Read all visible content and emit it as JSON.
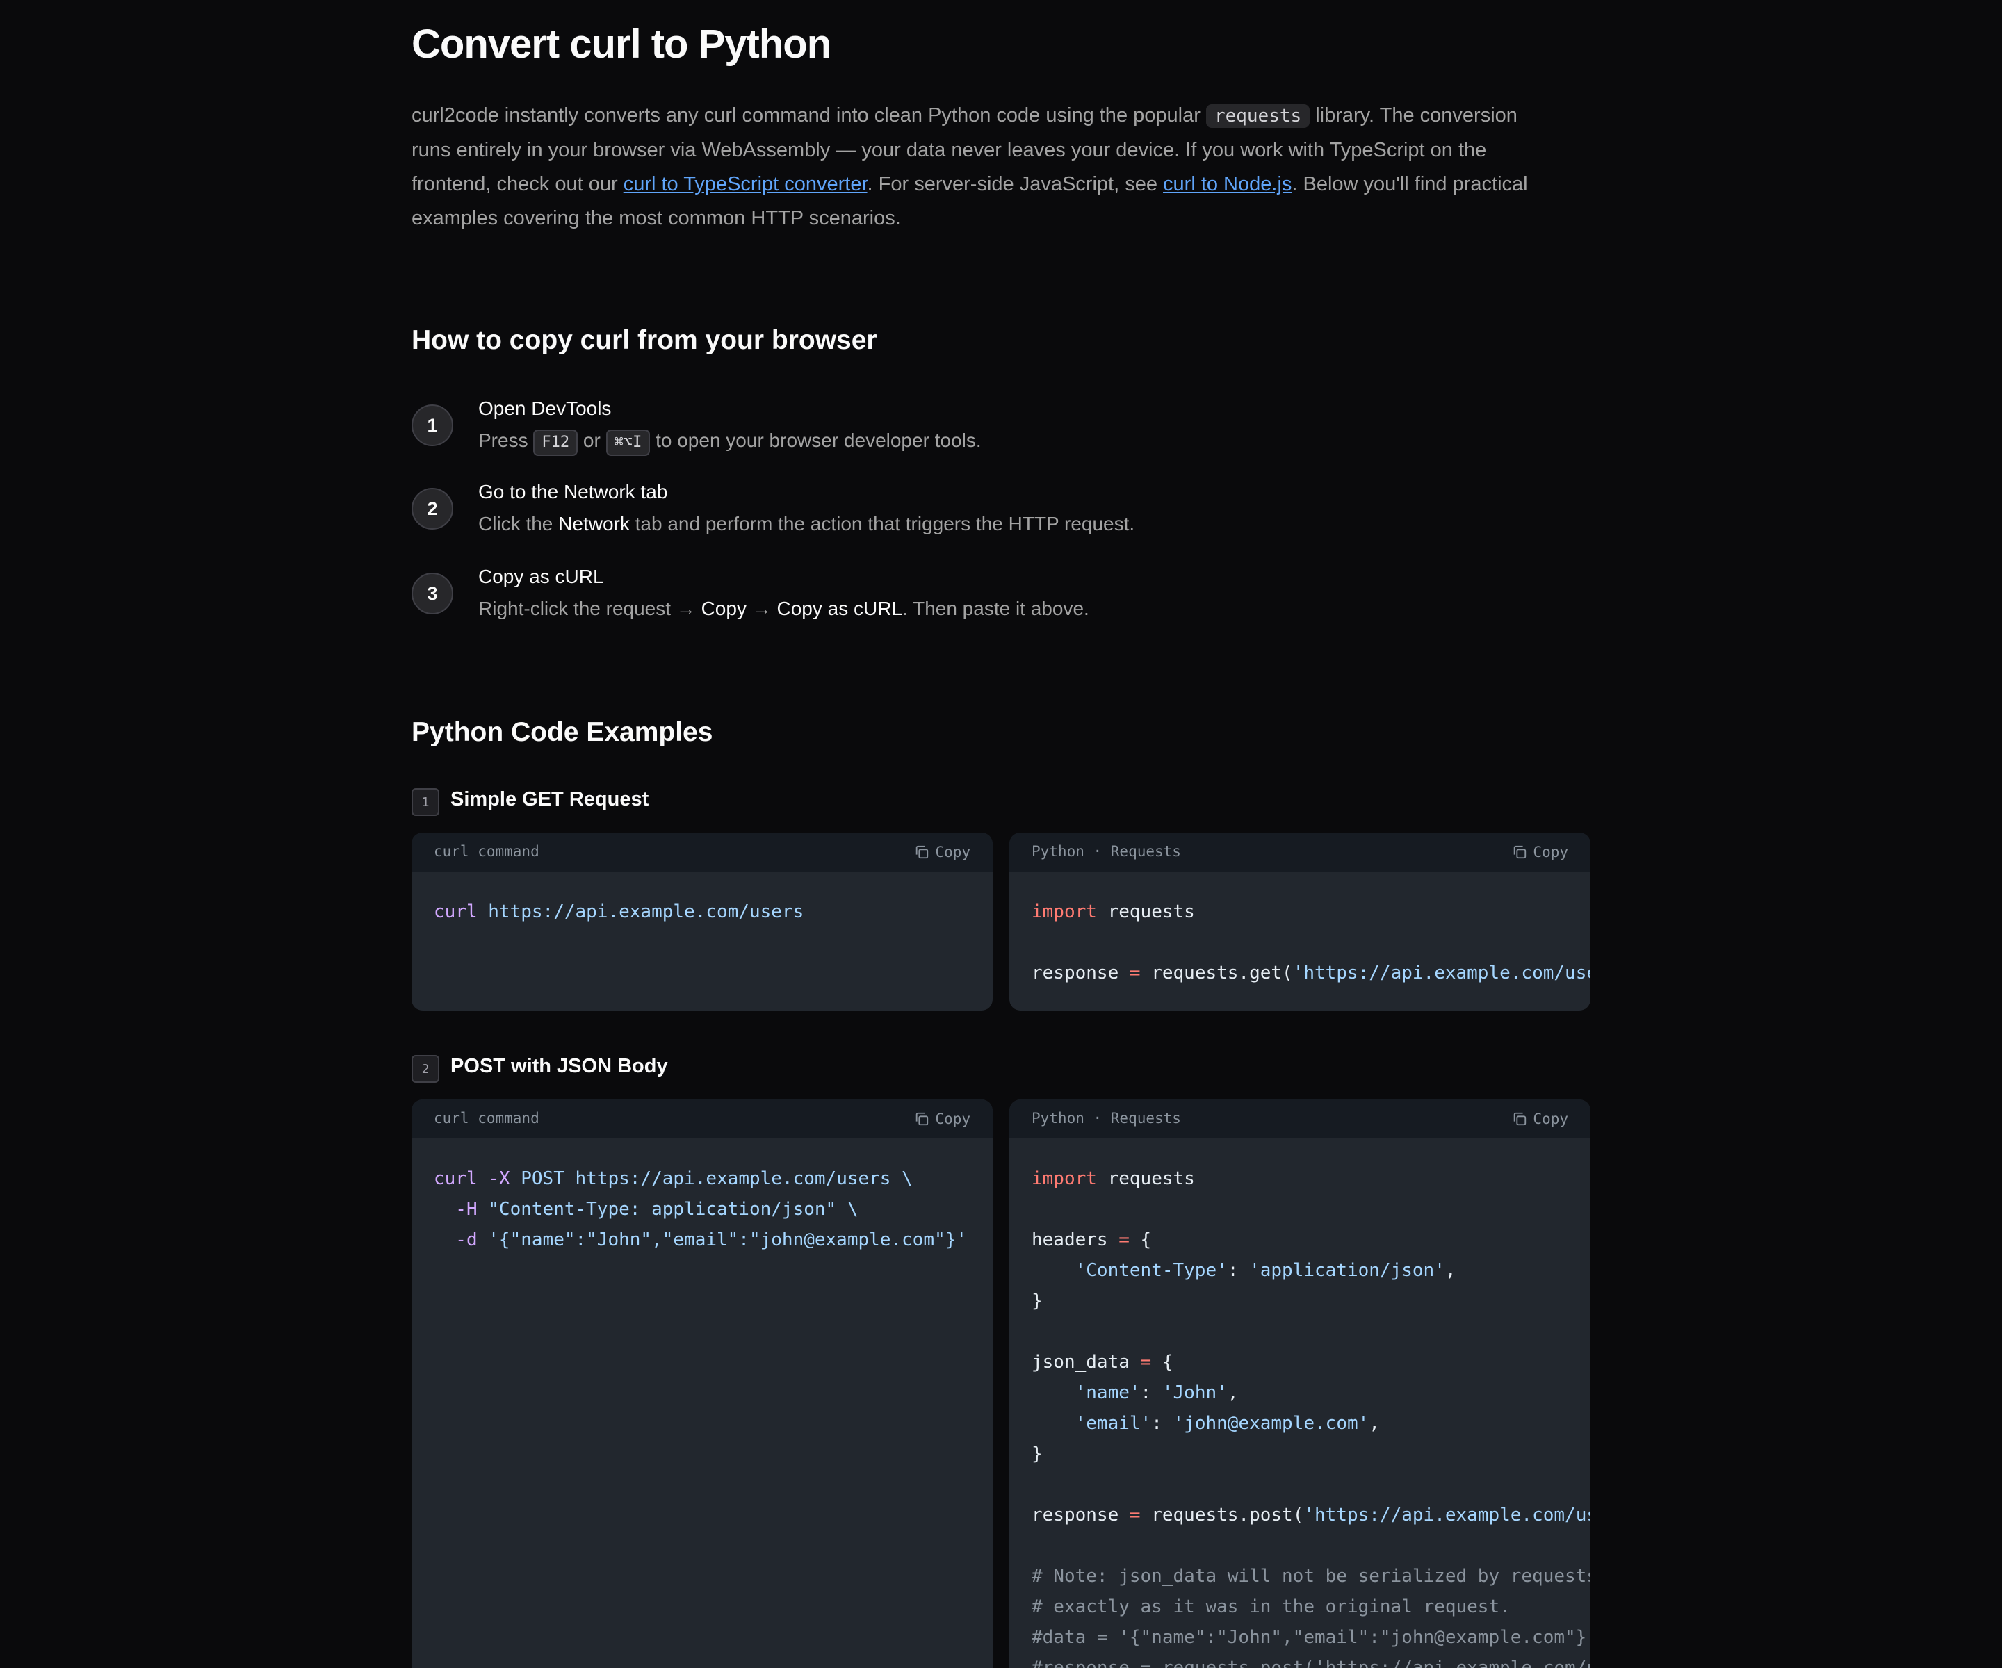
{
  "page": {
    "title": "Convert curl to Python",
    "intro": {
      "p1": "curl2code instantly converts any curl command into clean Python code using the popular ",
      "code": "requests",
      "p2": " library. The conversion runs entirely in your browser via WebAssembly — your data never leaves your device. If you work with TypeScript on the frontend, check out our ",
      "link1": "curl to TypeScript converter",
      "p3": ". For server-side JavaScript, see ",
      "link2": "curl to Node.js",
      "p4": ". Below you'll find practical examples covering the most common HTTP scenarios."
    }
  },
  "howto": {
    "heading": "How to copy curl from your browser",
    "steps": [
      {
        "num": "1",
        "title": "Open DevTools",
        "d1": "Press ",
        "k1": "F12",
        "d2": " or ",
        "k2": "⌘⌥I",
        "d3": " to open your browser developer tools."
      },
      {
        "num": "2",
        "title": "Go to the Network tab",
        "d1": "Click the ",
        "s1": "Network",
        "d2": " tab and perform the action that triggers the HTTP request."
      },
      {
        "num": "3",
        "title": "Copy as cURL",
        "d1": "Right-click the request → ",
        "s1": "Copy",
        "d2": " → ",
        "s2": "Copy as cURL",
        "d3": ". Then paste it above."
      }
    ]
  },
  "examples": {
    "heading": "Python Code Examples",
    "copy_label": "Copy",
    "curl_label": "curl command",
    "python_label": "Python · Requests",
    "items": [
      {
        "num": "1",
        "title": "Simple GET Request"
      },
      {
        "num": "2",
        "title": "POST with JSON Body"
      }
    ],
    "code": {
      "ex1_curl": [
        "curl",
        " https://api.example.com/users"
      ],
      "ex1_py": [
        "import",
        " requests",
        "response ",
        "=",
        " requests.get(",
        "'https://api.example.com/users')"
      ],
      "ex2_curl": [
        "curl",
        " -X",
        " POST https://api.example.com/users \\",
        "  -H",
        " \"Content-Type: application/json\" \\",
        "  -d",
        " '{\"name\":\"John\",\"email\":\"john@example.com\"}'"
      ],
      "ex2_py": [
        "import",
        " requests",
        "headers ",
        "=",
        " {",
        "    ",
        "'Content-Type'",
        ": ",
        "'application/json'",
        ",",
        "}",
        "json_data ",
        "=",
        " {",
        "    ",
        "'name'",
        ": ",
        "'John'",
        ",",
        "    ",
        "'email'",
        ": ",
        "'john@example.com'",
        ",",
        "}",
        "response ",
        "=",
        " requests.post(",
        "'https://api.example.com/users', headers=headers, json=json_data)",
        "# Note: json_data will not be serialized by requests",
        "# exactly as it was in the original request.",
        "#data = '{\"name\":\"John\",\"email\":\"john@example.com\"}'",
        "#response = requests.post('https://api.example.com/users', headers=headers, data=data)"
      ]
    }
  }
}
